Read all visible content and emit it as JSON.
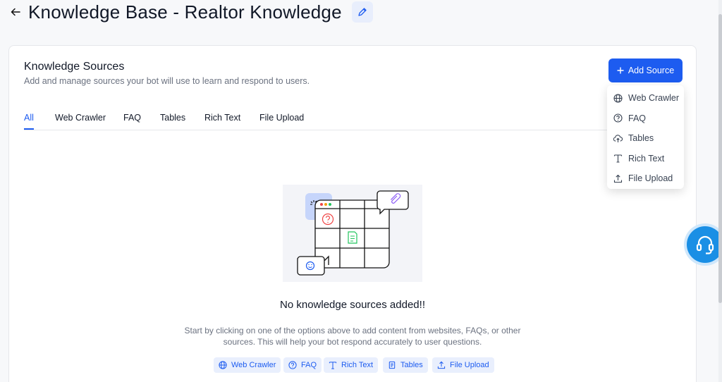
{
  "header": {
    "back_icon": "arrow-left-icon",
    "title": "Knowledge Base - Realtor Knowledge",
    "edit_icon": "pencil-icon"
  },
  "card": {
    "title": "Knowledge Sources",
    "subtitle": "Add and manage sources your bot will use to learn and respond to users.",
    "add_button_label": "Add Source",
    "add_button_icon": "plus-icon"
  },
  "tabs": [
    {
      "label": "All",
      "active": true
    },
    {
      "label": "Web Crawler"
    },
    {
      "label": "FAQ"
    },
    {
      "label": "Tables"
    },
    {
      "label": "Rich Text"
    },
    {
      "label": "File Upload"
    }
  ],
  "dropdown": {
    "items": [
      {
        "label": "Web Crawler",
        "icon": "globe-icon"
      },
      {
        "label": "FAQ",
        "icon": "question-circle-icon"
      },
      {
        "label": "Tables",
        "icon": "cloud-upload-icon"
      },
      {
        "label": "Rich Text",
        "icon": "text-t-icon"
      },
      {
        "label": "File Upload",
        "icon": "upload-icon"
      }
    ]
  },
  "empty_state": {
    "title": "No knowledge sources added!!",
    "description": "Start by clicking on one of the options above to add content from websites, FAQs, or other sources. This will help your bot respond accurately to user questions."
  },
  "quick_buttons": [
    {
      "label": "Web Crawler",
      "icon": "globe-icon"
    },
    {
      "label": "FAQ",
      "icon": "question-circle-icon"
    },
    {
      "label": "Rich Text",
      "icon": "text-t-icon"
    },
    {
      "label": "Tables",
      "icon": "document-icon"
    },
    {
      "label": "File Upload",
      "icon": "upload-icon"
    }
  ],
  "support_icon": "headset-icon",
  "colors": {
    "accent": "#1d5cf0",
    "support": "#1a8fe5"
  }
}
